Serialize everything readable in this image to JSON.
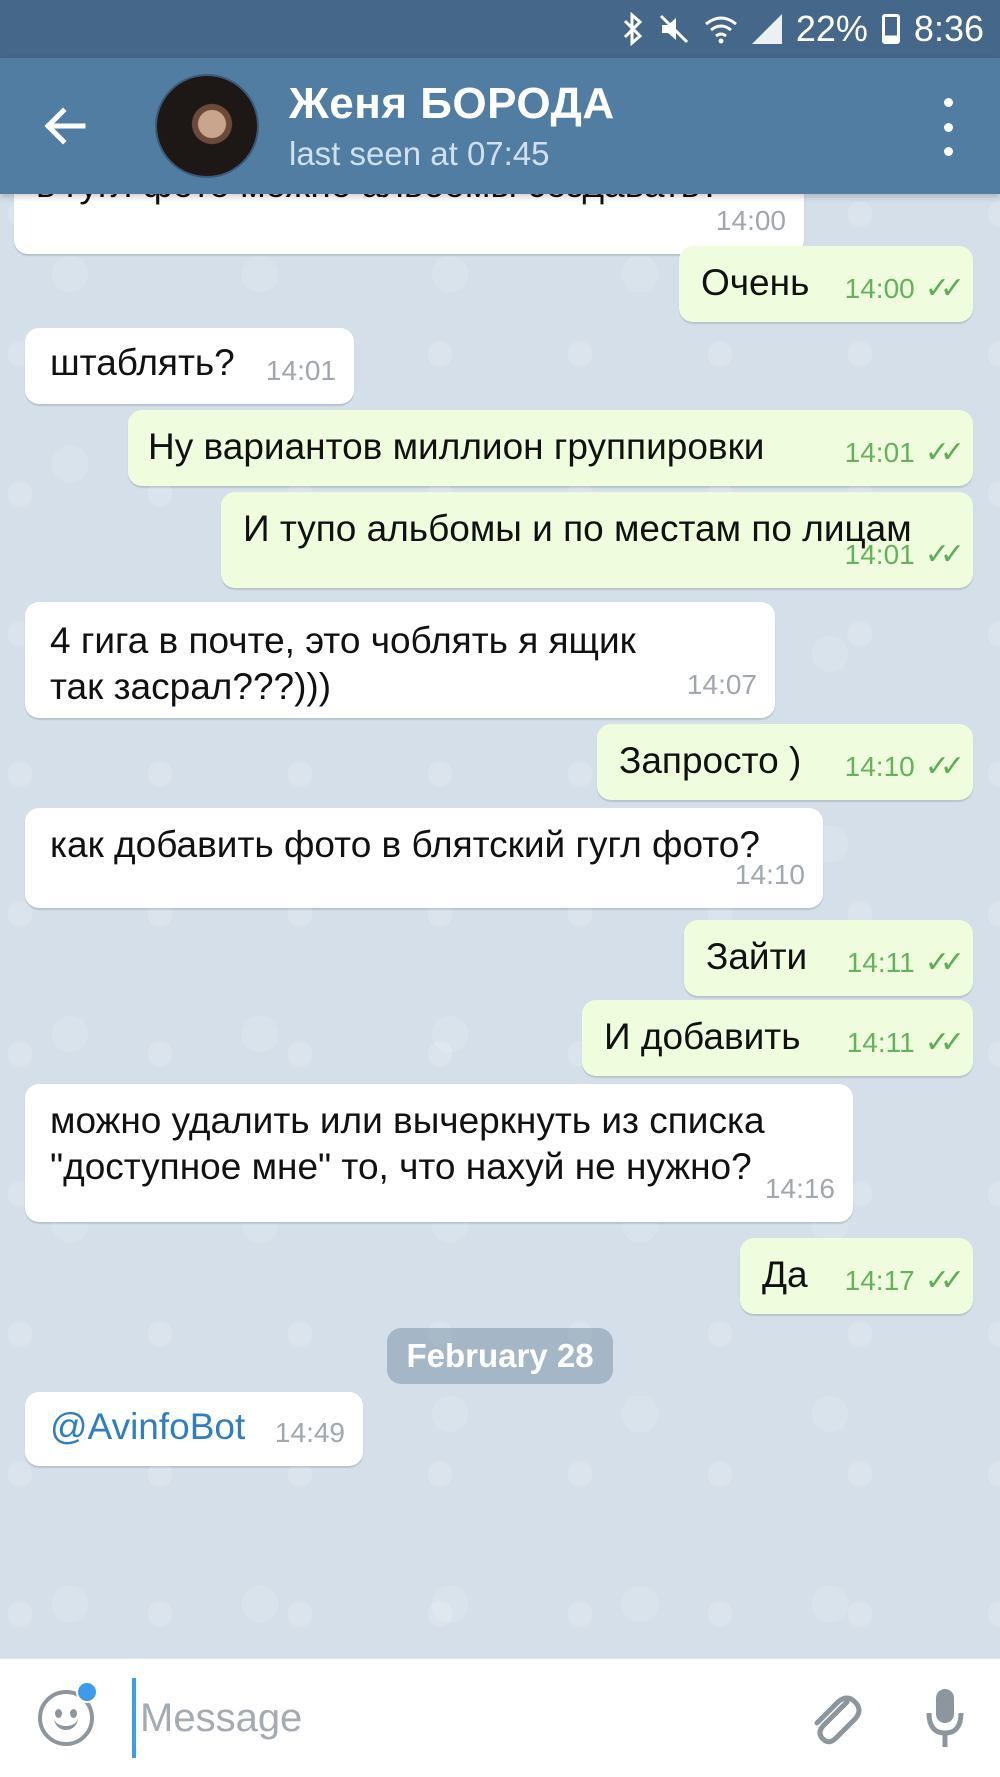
{
  "status_bar": {
    "battery": "22%",
    "time": "8:36"
  },
  "header": {
    "contact_name": "Женя БОРОДА",
    "last_seen": "last seen at 07:45"
  },
  "messages": [
    {
      "dir": "in",
      "text": "в гугл фото можно альбомы создавать?",
      "time": "14:00"
    },
    {
      "dir": "out",
      "text": "Очень",
      "time": "14:00"
    },
    {
      "dir": "in",
      "text": "штаблять?",
      "time": "14:01"
    },
    {
      "dir": "out",
      "text": "Ну вариантов миллион группировки",
      "time": "14:01"
    },
    {
      "dir": "out",
      "text": "И тупо альбомы и по местам по лицам",
      "time": "14:01"
    },
    {
      "dir": "in",
      "text": "4 гига в почте, это чоблять я ящик так засрал???)))",
      "time": "14:07"
    },
    {
      "dir": "out",
      "text": "Запросто )",
      "time": "14:10"
    },
    {
      "dir": "in",
      "text": "как добавить фото в блятский гугл фото?",
      "time": "14:10"
    },
    {
      "dir": "out",
      "text": "Зайти",
      "time": "14:11"
    },
    {
      "dir": "out",
      "text": "И добавить",
      "time": "14:11"
    },
    {
      "dir": "in",
      "text": "можно удалить или вычеркнуть из списка \"доступное мне\" то, что нахуй не нужно?",
      "time": "14:16"
    },
    {
      "dir": "out",
      "text": "Да",
      "time": "14:17"
    },
    {
      "dir": "in",
      "text": "@AvinfoBot",
      "time": "14:49"
    }
  ],
  "date_separator": "February 28",
  "input": {
    "placeholder": "Message"
  },
  "colors": {
    "header": "#517da2",
    "status_bar": "#44678a",
    "outgoing_bubble": "#effdde",
    "incoming_bubble": "#ffffff",
    "chat_background": "#d4dfe9",
    "accent": "#3d9be9"
  },
  "icons": [
    "bluetooth-icon",
    "mute-icon",
    "wifi-icon",
    "signal-icon",
    "battery-icon",
    "back-arrow-icon",
    "menu-dots-icon",
    "emoji-icon",
    "attach-icon",
    "mic-icon",
    "double-check-icon"
  ]
}
